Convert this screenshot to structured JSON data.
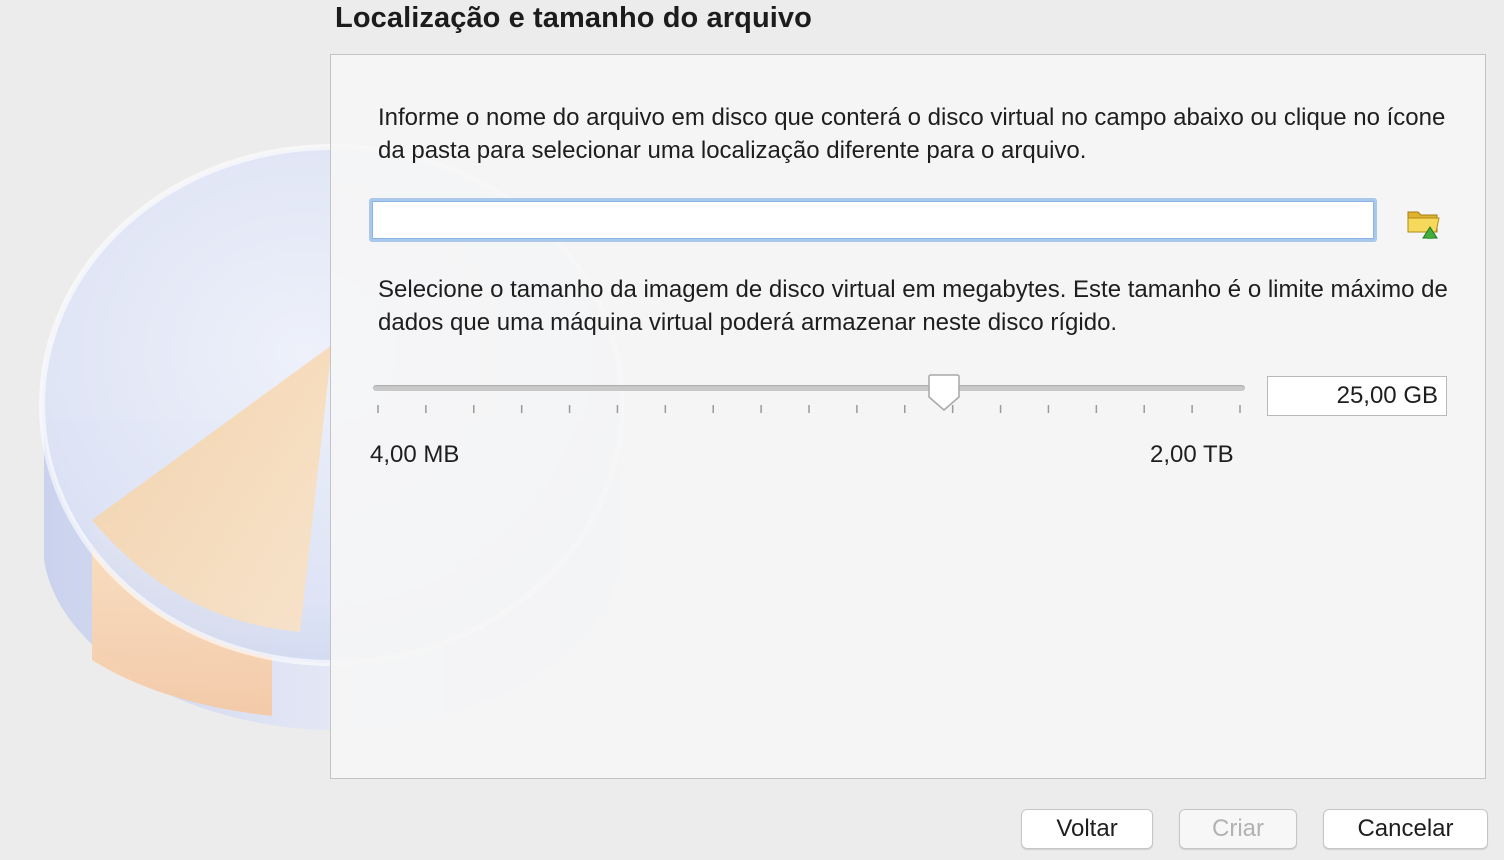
{
  "page": {
    "title": "Localização e tamanho do arquivo"
  },
  "location": {
    "description": "Informe o nome do arquivo em disco que conterá o disco virtual no campo abaixo ou clique no ícone da pasta para selecionar uma localização diferente para o arquivo.",
    "file_value": "",
    "folder_icon": "folder-open-icon"
  },
  "size": {
    "description": "Selecione o tamanho da imagem de disco virtual em megabytes. Este tamanho é o limite máximo de dados que uma máquina virtual poderá armazenar neste disco rígido.",
    "value": "25,00 GB",
    "slider_fraction": 0.657,
    "tick_count": 19,
    "min_label": "4,00 MB",
    "max_label": "2,00 TB"
  },
  "buttons": {
    "back": "Voltar",
    "create": "Criar",
    "cancel": "Cancelar"
  },
  "watermark_icon": "hard-disk-icon",
  "colors": {
    "background": "#ececec",
    "input_focus": "#a9c8ec",
    "disabled_text": "#b2b2b2"
  }
}
